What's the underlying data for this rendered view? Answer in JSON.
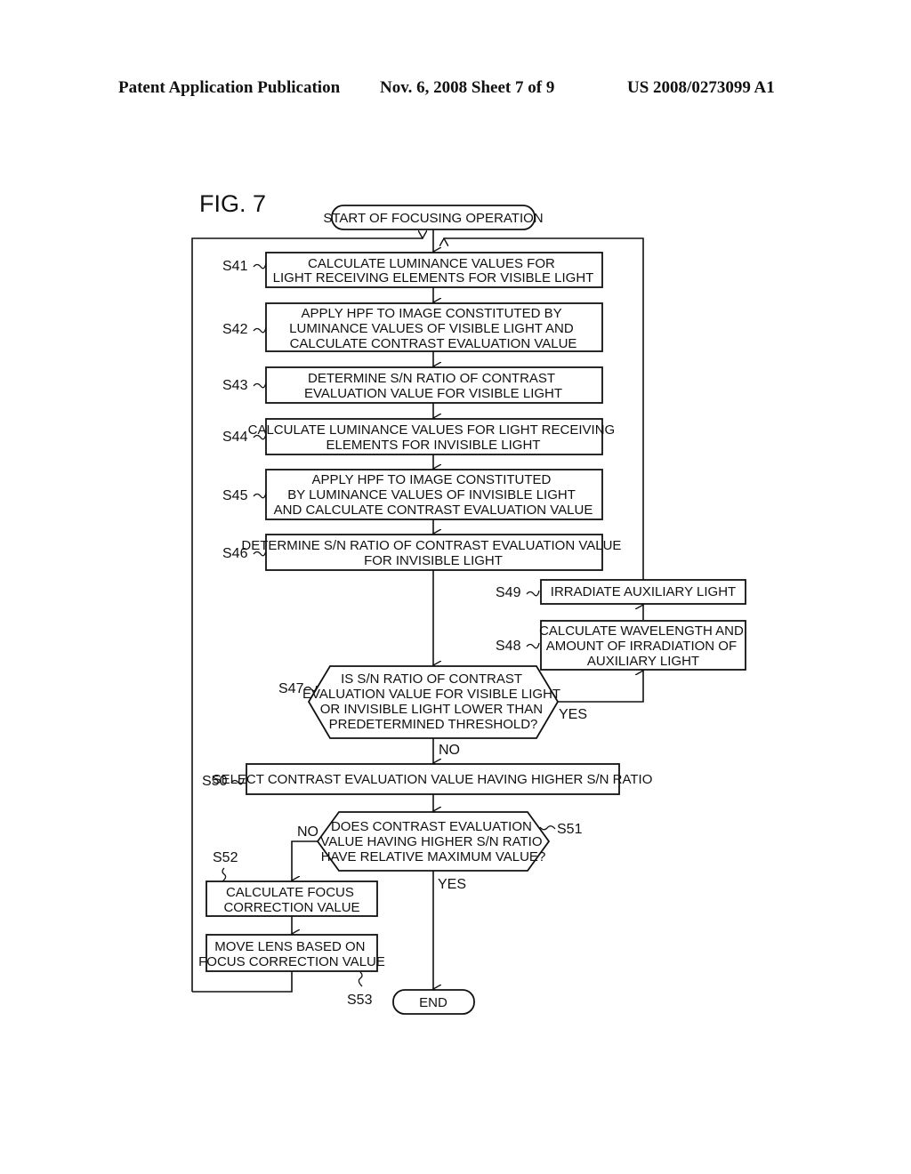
{
  "header": {
    "left": "Patent Application Publication",
    "middle": "Nov. 6, 2008   Sheet 7 of 9",
    "right": "US 2008/0273099 A1"
  },
  "figure": {
    "title": "FIG. 7",
    "start": "START OF FOCUSING OPERATION",
    "end": "END",
    "steps": {
      "S41": {
        "label": "S41",
        "lines": [
          "CALCULATE LUMINANCE VALUES FOR",
          "LIGHT RECEIVING ELEMENTS FOR VISIBLE LIGHT"
        ]
      },
      "S42": {
        "label": "S42",
        "lines": [
          "APPLY HPF TO IMAGE CONSTITUTED BY",
          "LUMINANCE VALUES OF VISIBLE LIGHT AND",
          "CALCULATE CONTRAST EVALUATION VALUE"
        ]
      },
      "S43": {
        "label": "S43",
        "lines": [
          "DETERMINE S/N RATIO OF CONTRAST",
          "EVALUATION VALUE FOR VISIBLE LIGHT"
        ]
      },
      "S44": {
        "label": "S44",
        "lines": [
          "CALCULATE LUMINANCE VALUES FOR LIGHT RECEIVING",
          "ELEMENTS FOR INVISIBLE LIGHT"
        ]
      },
      "S45": {
        "label": "S45",
        "lines": [
          "APPLY HPF TO IMAGE CONSTITUTED",
          "BY LUMINANCE VALUES OF INVISIBLE LIGHT",
          "AND CALCULATE CONTRAST EVALUATION VALUE"
        ]
      },
      "S46": {
        "label": "S46",
        "lines": [
          "DETERMINE S/N RATIO OF CONTRAST EVALUATION VALUE",
          "FOR INVISIBLE LIGHT"
        ]
      },
      "S47": {
        "label": "S47",
        "lines": [
          "IS S/N RATIO OF CONTRAST",
          "EVALUATION VALUE FOR VISIBLE LIGHT",
          "OR INVISIBLE LIGHT LOWER THAN",
          "PREDETERMINED THRESHOLD?"
        ],
        "yes": "YES",
        "no": "NO"
      },
      "S48": {
        "label": "S48",
        "lines": [
          "CALCULATE WAVELENGTH AND",
          "AMOUNT OF IRRADIATION OF",
          "AUXILIARY LIGHT"
        ]
      },
      "S49": {
        "label": "S49",
        "lines": [
          "IRRADIATE AUXILIARY LIGHT"
        ]
      },
      "S50": {
        "label": "S50",
        "lines": [
          "SELECT CONTRAST EVALUATION VALUE HAVING HIGHER S/N RATIO"
        ]
      },
      "S51": {
        "label": "S51",
        "lines": [
          "DOES CONTRAST EVALUATION",
          "VALUE HAVING HIGHER S/N RATIO",
          "HAVE RELATIVE MAXIMUM VALUE?"
        ],
        "yes": "YES",
        "no": "NO"
      },
      "S52": {
        "label": "S52",
        "lines": [
          "CALCULATE FOCUS",
          "CORRECTION VALUE"
        ]
      },
      "S53": {
        "label": "S53",
        "lines": [
          "MOVE LENS BASED ON",
          "FOCUS CORRECTION VALUE"
        ]
      }
    }
  }
}
